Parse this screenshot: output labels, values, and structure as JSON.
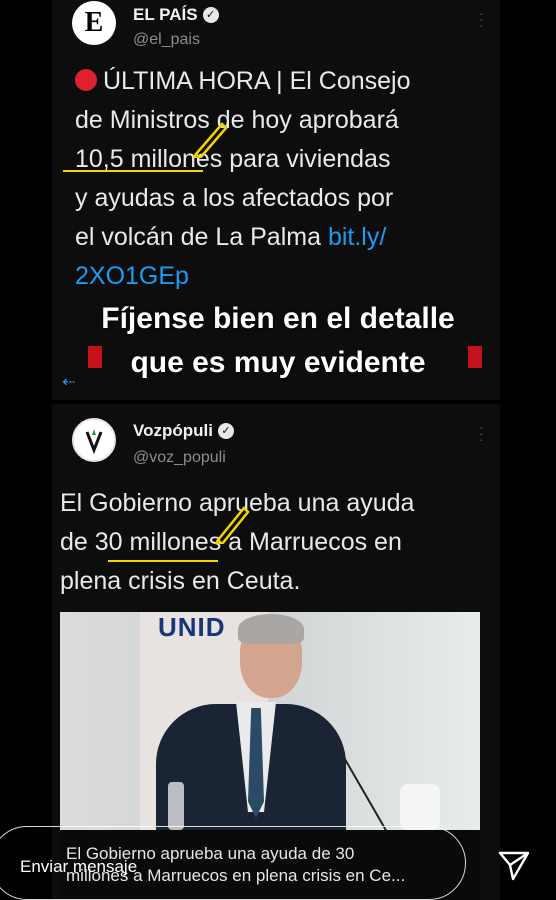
{
  "tweet1": {
    "avatar_letter": "E",
    "account_name": "EL PAÍS",
    "handle": "@el_pais",
    "text_line1": "ÚLTIMA HORA | El Consejo",
    "text_line2": "de Ministros de hoy aprobará",
    "text_line3": "10,5 millones para viviendas",
    "text_line4": "y ayudas a los afectados por",
    "text_line5_plain": "el volcán de La Palma ",
    "text_line5_link": "bit.ly/",
    "text_line6_link": "2XO1GEp"
  },
  "overlay": {
    "line1": "Fíjense bien en el detalle",
    "line2": "que es muy evidente"
  },
  "tweet2": {
    "avatar_letter": "V",
    "account_name": "Vozpópuli",
    "handle": "@voz_populi",
    "text_line1": "El Gobierno aprueba una ayuda",
    "text_line2": "de 30 millones a Marruecos en",
    "text_line3": "plena crisis en Ceuta."
  },
  "image": {
    "banner_text": "UNID"
  },
  "caption": {
    "line1": "El Gobierno aprueba una ayuda de 30",
    "line2": "millones a Marruecos en plena crisis en Ce..."
  },
  "story_footer": {
    "message_placeholder": "Enviar mensaje",
    "send_icon": "paper-plane-icon"
  },
  "colors": {
    "link": "#1d9bf0",
    "highlight": "#f2d400",
    "red_dot": "#e0202d"
  }
}
